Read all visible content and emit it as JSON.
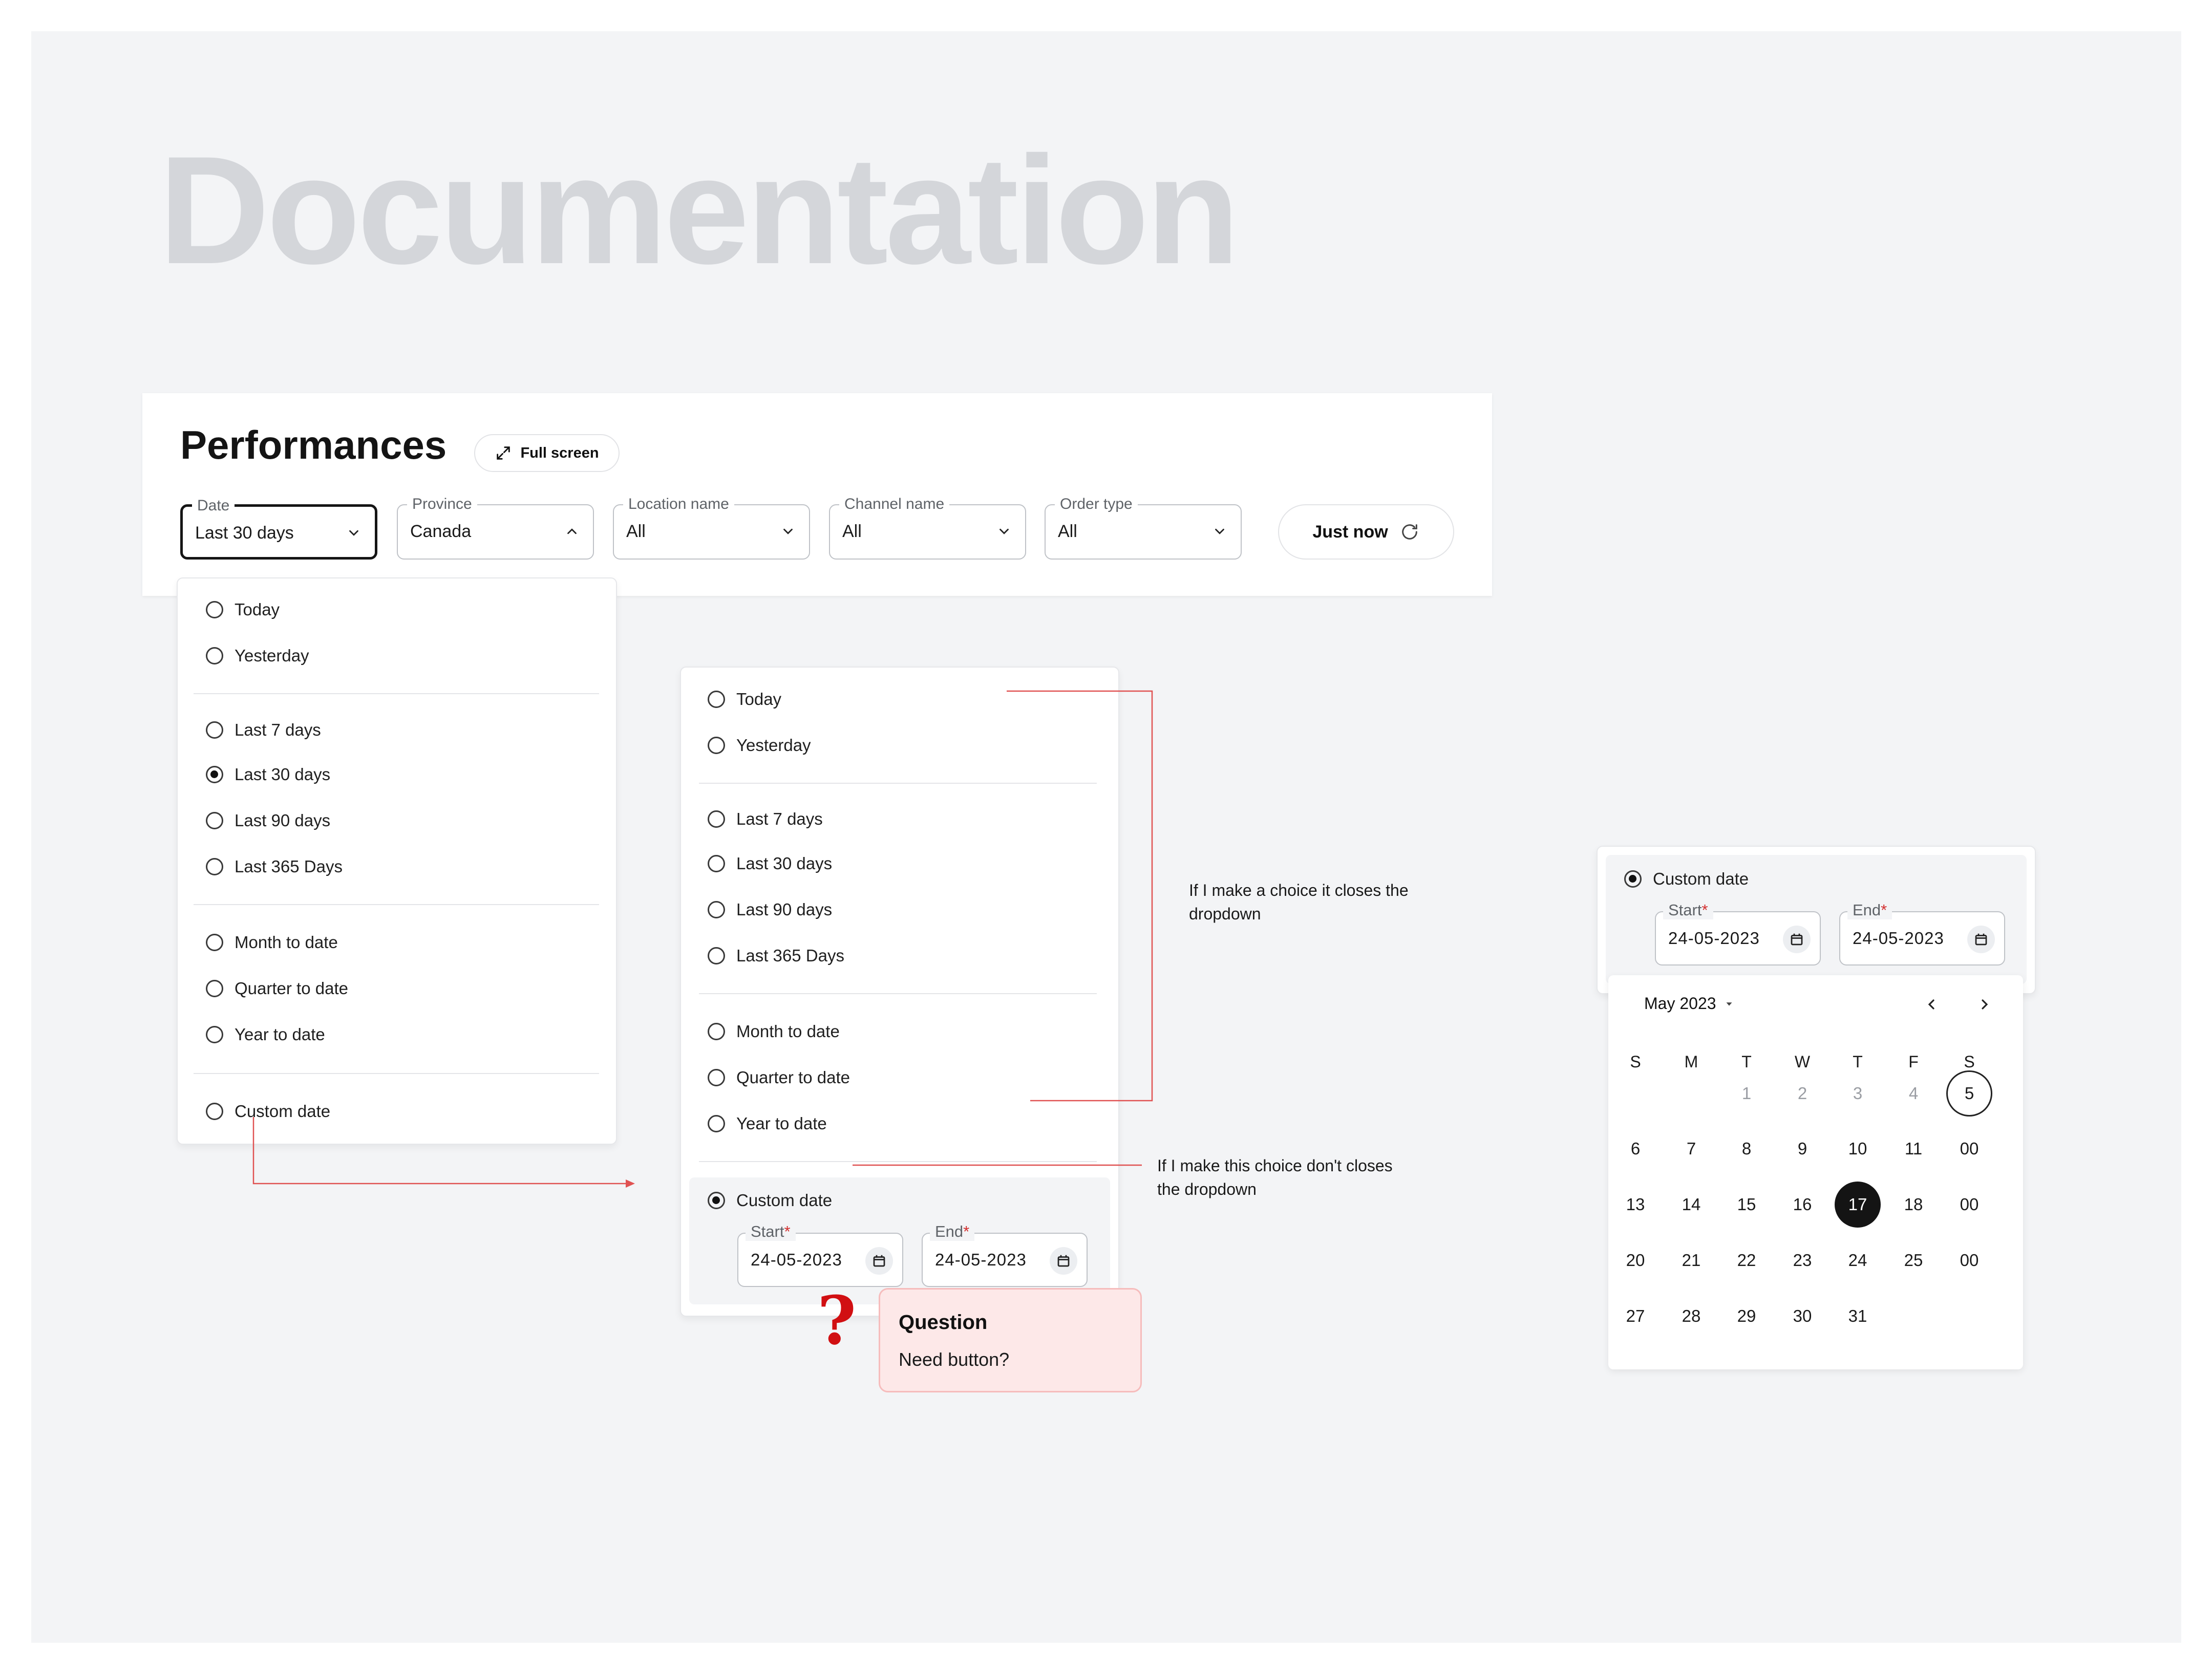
{
  "title": "Documentation",
  "panel": {
    "heading": "Performances",
    "fullscreen_label": "Full screen",
    "refresh_label": "Just now",
    "filters": [
      {
        "label": "Date",
        "value": "Last 30 days",
        "open": true
      },
      {
        "label": "Province",
        "value": "Canada",
        "open": false
      },
      {
        "label": "Location name",
        "value": "All",
        "open": false
      },
      {
        "label": "Channel name",
        "value": "All",
        "open": false
      },
      {
        "label": "Order type",
        "value": "All",
        "open": false
      }
    ]
  },
  "date_options": {
    "today": "Today",
    "yesterday": "Yesterday",
    "last7": "Last 7 days",
    "last30": "Last 30 days",
    "last90": "Last 90 days",
    "last365": "Last 365 Days",
    "mtd": "Month to date",
    "qtd": "Quarter to date",
    "ytd": "Year to date",
    "custom": "Custom date"
  },
  "dropdown1_selected": "Last 30 days",
  "dropdown2_selected": "Custom date",
  "custom_range": {
    "start_label": "Start",
    "end_label": "End",
    "required_mark": "*",
    "start_value": "24-05-2023",
    "end_value": "24-05-2023"
  },
  "notes": {
    "closes": "If I make a choice it closes the dropdown",
    "not_closes": "If I make this choice don't closes the dropdown"
  },
  "question": {
    "mark": "?",
    "title": "Question",
    "body": "Need button?"
  },
  "calendar": {
    "month_label": "May 2023",
    "weekdays": [
      "S",
      "M",
      "T",
      "W",
      "T",
      "F",
      "S"
    ],
    "weeks": [
      [
        "",
        "",
        "1",
        "2",
        "3",
        "4",
        "5"
      ],
      [
        "6",
        "7",
        "8",
        "9",
        "10",
        "11",
        "00"
      ],
      [
        "13",
        "14",
        "15",
        "16",
        "17",
        "18",
        "00"
      ],
      [
        "20",
        "21",
        "22",
        "23",
        "24",
        "25",
        "00"
      ],
      [
        "27",
        "28",
        "29",
        "30",
        "31",
        "",
        ""
      ]
    ],
    "muted_days": [
      "1",
      "2",
      "3",
      "4"
    ],
    "today_day": "5",
    "selected_day": "17"
  },
  "colors": {
    "accent_dark": "#141414",
    "annotation_line": "#e05252",
    "required": "#d32f2f",
    "question_bg": "#fde8e8",
    "question_mark": "#d10f12",
    "title_gray": "#d4d6da"
  }
}
